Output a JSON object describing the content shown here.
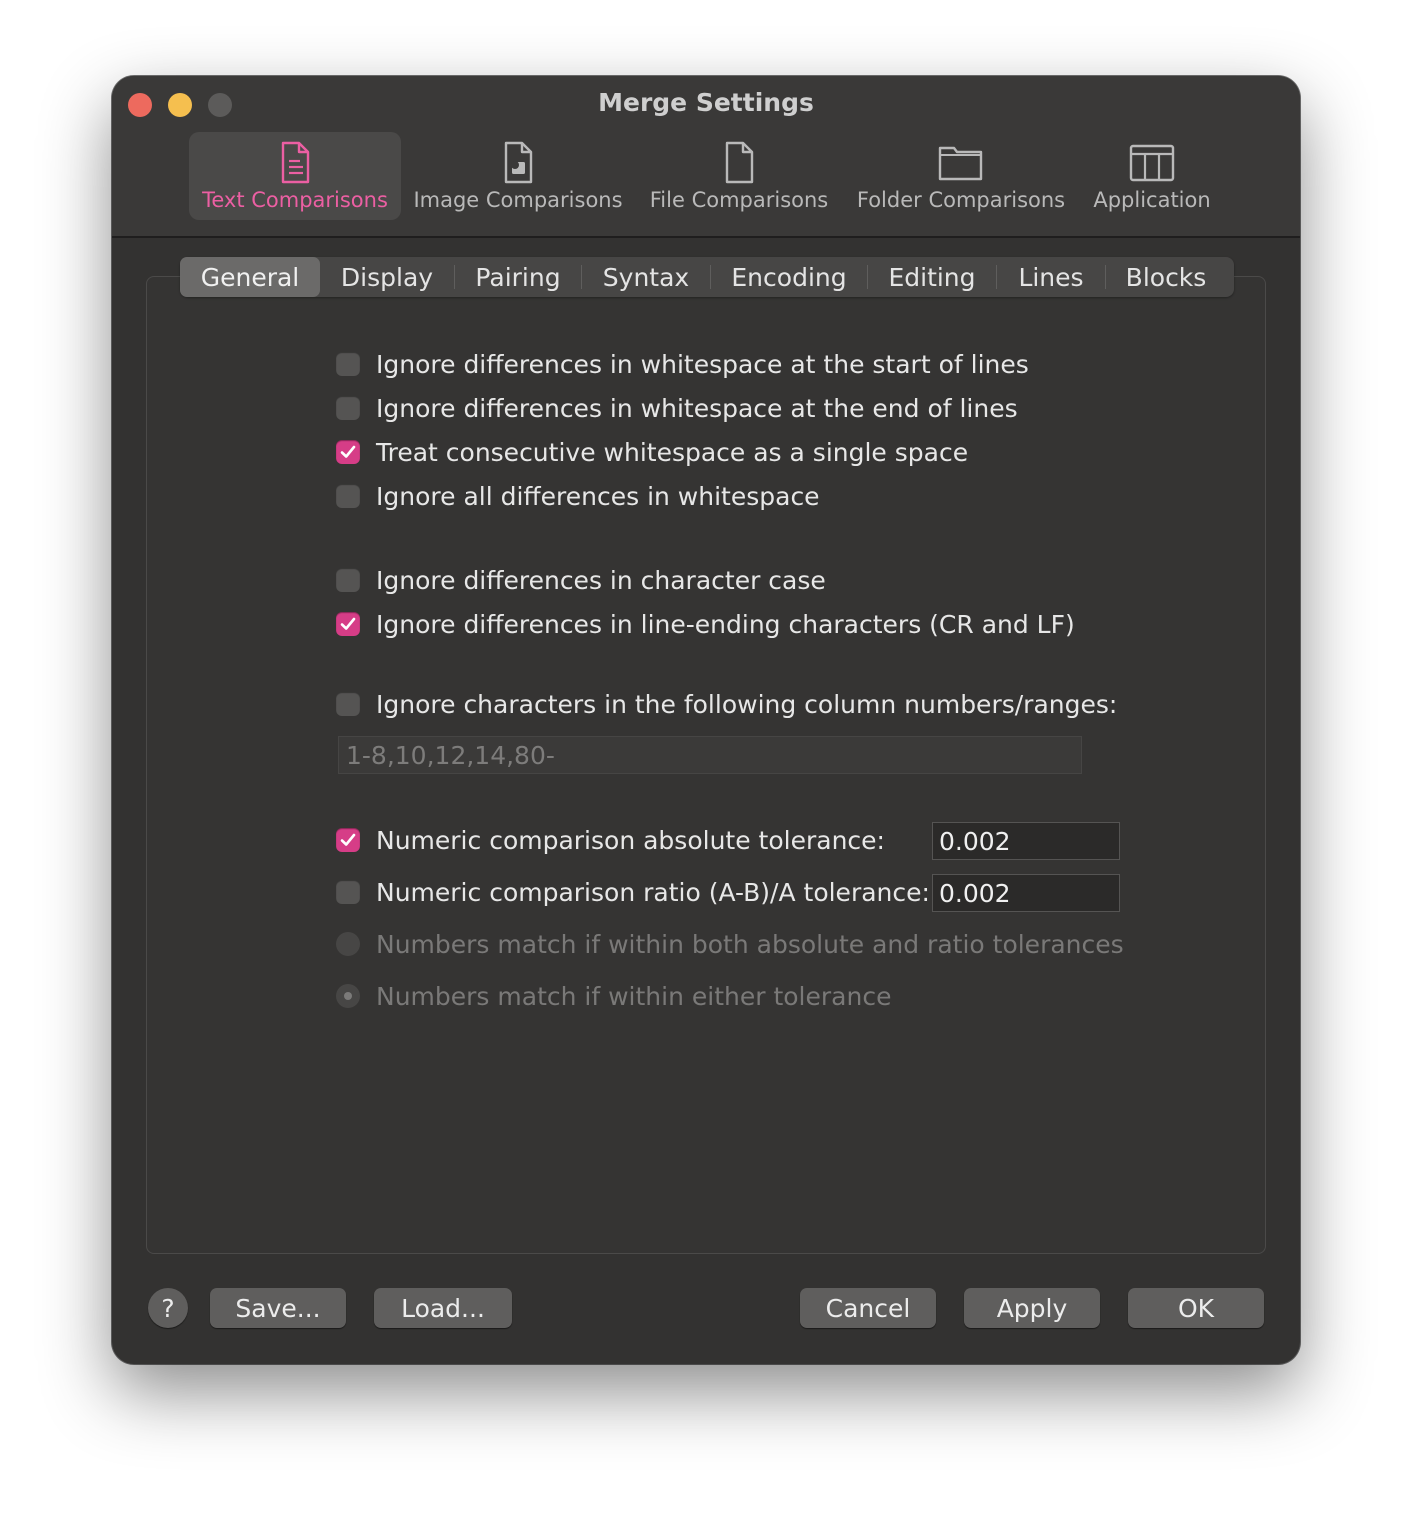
{
  "window": {
    "title": "Merge Settings"
  },
  "toolbar": {
    "tabs": [
      {
        "label": "Text Comparisons",
        "icon": "text-document-icon",
        "active": true
      },
      {
        "label": "Image Comparisons",
        "icon": "image-document-icon",
        "active": false
      },
      {
        "label": "File Comparisons",
        "icon": "file-icon",
        "active": false
      },
      {
        "label": "Folder Comparisons",
        "icon": "folder-icon",
        "active": false
      },
      {
        "label": "Application",
        "icon": "table-icon",
        "active": false
      }
    ]
  },
  "subtabs": [
    "General",
    "Display",
    "Pairing",
    "Syntax",
    "Encoding",
    "Editing",
    "Lines",
    "Blocks"
  ],
  "subtabs_active": "General",
  "options": {
    "ws_start": {
      "label": "Ignore differences in whitespace at the start of lines",
      "checked": false
    },
    "ws_end": {
      "label": "Ignore differences in whitespace at the end of lines",
      "checked": false
    },
    "ws_consecutive": {
      "label": "Treat consecutive whitespace as a single space",
      "checked": true
    },
    "ws_all": {
      "label": "Ignore all differences in whitespace",
      "checked": false
    },
    "char_case": {
      "label": "Ignore differences in character case",
      "checked": false
    },
    "line_endings": {
      "label": "Ignore differences in line-ending characters (CR and LF)",
      "checked": true
    },
    "columns": {
      "label": "Ignore characters in the following column numbers/ranges:",
      "checked": false,
      "placeholder": "1-8,10,12,14,80-"
    },
    "abs_tolerance": {
      "label": "Numeric comparison absolute tolerance:",
      "checked": true,
      "value": "0.002"
    },
    "ratio_tolerance": {
      "label": "Numeric comparison ratio (A-B)/A tolerance:",
      "checked": false,
      "value": "0.002"
    },
    "match_both": {
      "label": "Numbers match if within both absolute and ratio tolerances",
      "selected": false
    },
    "match_either": {
      "label": "Numbers match if within either tolerance",
      "selected": true
    }
  },
  "buttons": {
    "help": "?",
    "save": "Save...",
    "load": "Load...",
    "cancel": "Cancel",
    "apply": "Apply",
    "ok": "OK"
  },
  "colors": {
    "accent": "#d63d87",
    "accent_text": "#ec5fa3",
    "window_bg": "#333231"
  }
}
